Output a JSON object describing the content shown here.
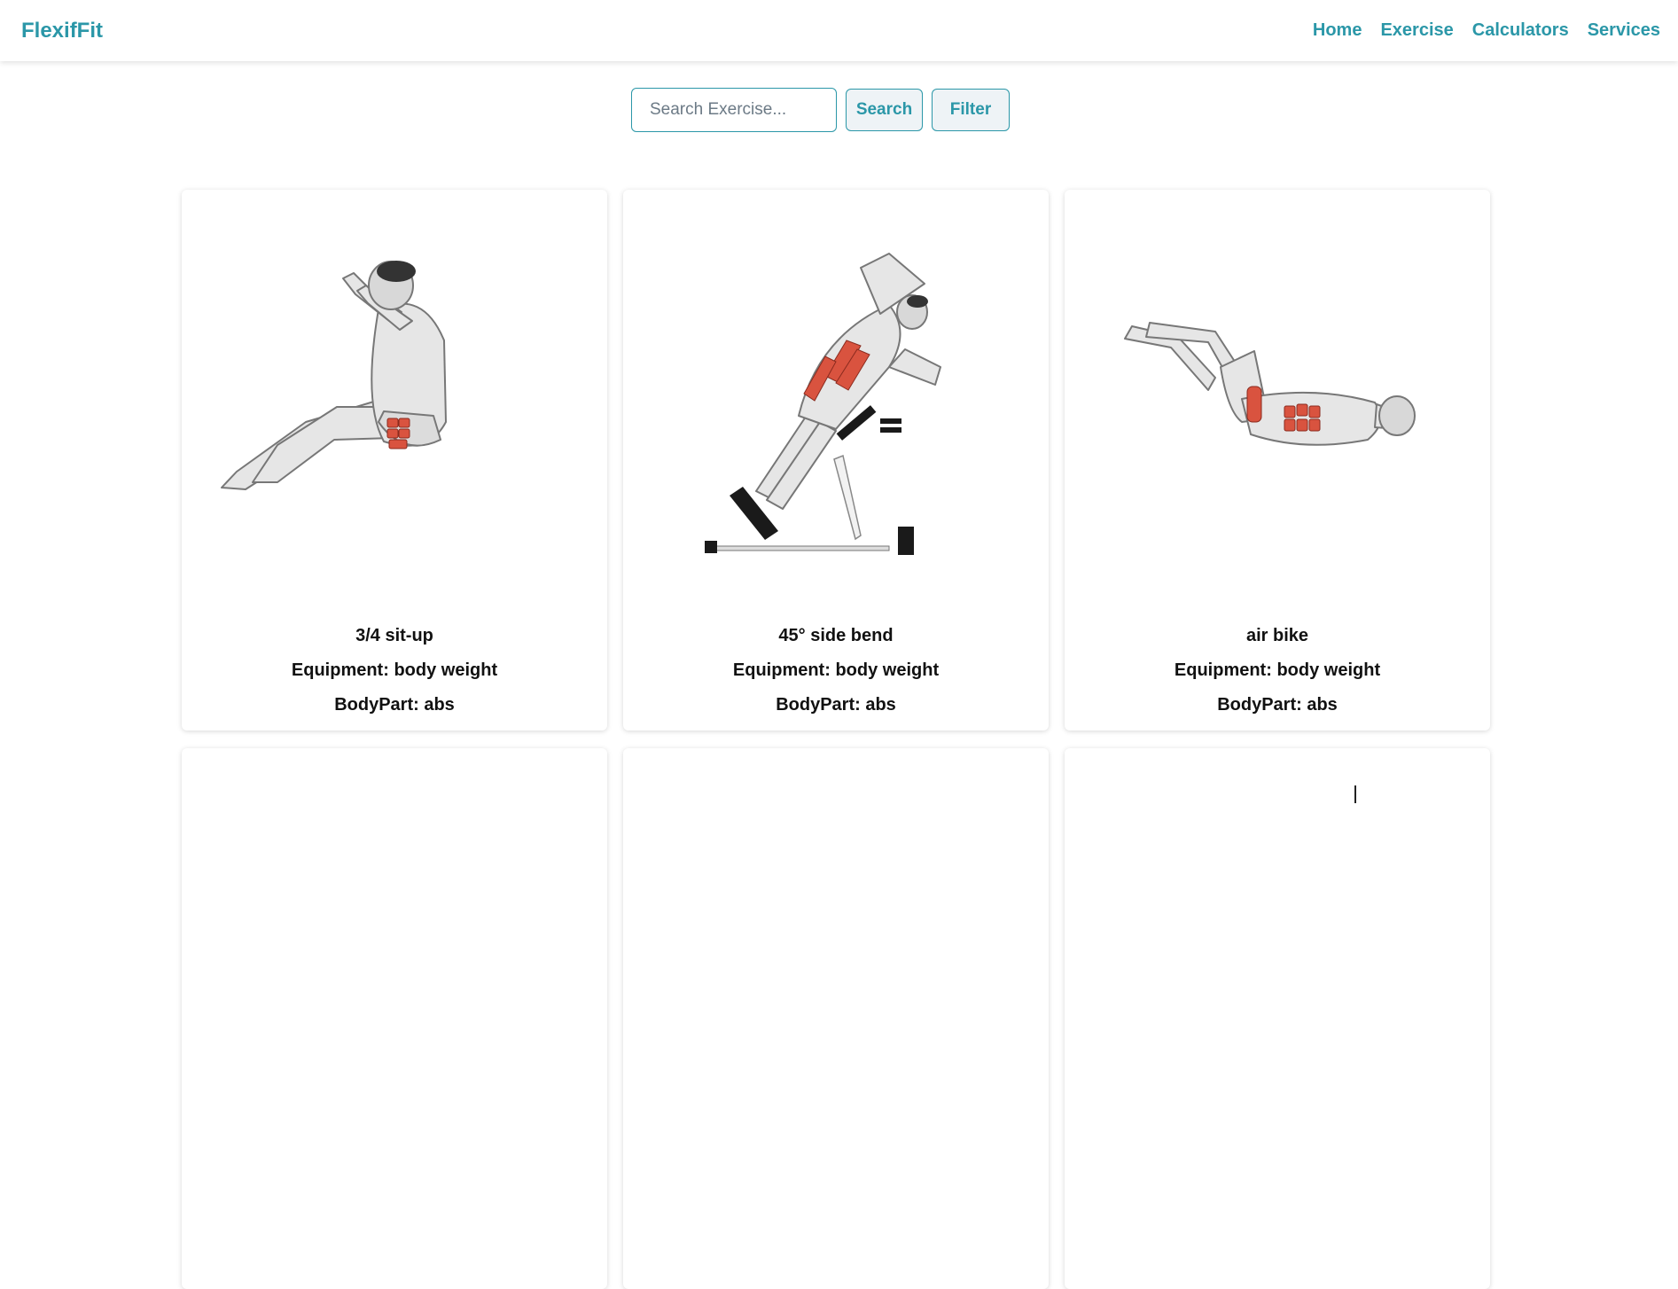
{
  "brand": "FlexifFit",
  "nav": {
    "items": [
      {
        "label": "Home"
      },
      {
        "label": "Exercise"
      },
      {
        "label": "Calculators"
      },
      {
        "label": "Services"
      }
    ]
  },
  "search": {
    "placeholder": "Search Exercise...",
    "value": "",
    "search_label": "Search",
    "filter_label": "Filter"
  },
  "colors": {
    "accent": "#2b97a8",
    "muscle": "#d9533f"
  },
  "cards": [
    {
      "name": "3/4 sit-up",
      "equipment": "Equipment: body weight",
      "bodypart": "BodyPart: abs",
      "image": "sit-up-figure"
    },
    {
      "name": "45° side bend",
      "equipment": "Equipment: body weight",
      "bodypart": "BodyPart: abs",
      "image": "side-bend-figure"
    },
    {
      "name": "air bike",
      "equipment": "Equipment: body weight",
      "bodypart": "BodyPart: abs",
      "image": "air-bike-figure"
    }
  ]
}
